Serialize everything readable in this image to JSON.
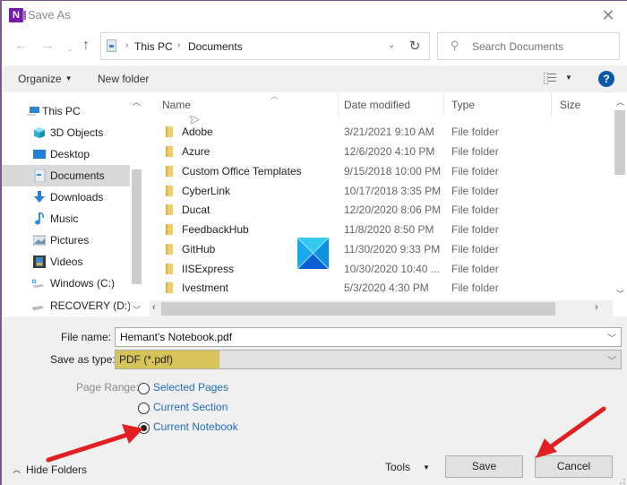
{
  "window": {
    "title": "Save As",
    "app_icon_letter": "N",
    "close_glyph": "✕"
  },
  "nav": {
    "back_glyph": "←",
    "forward_glyph": "→",
    "recent_glyph": "⌄",
    "up_glyph": "↑",
    "breadcrumb": [
      "This PC",
      "Documents"
    ],
    "separator_glyph": "›",
    "dropdown_glyph": "⌄",
    "refresh_glyph": "↻",
    "search_placeholder": "Search Documents"
  },
  "toolbar": {
    "organize_label": "Organize",
    "new_folder_label": "New folder",
    "help_label": "?"
  },
  "sidebar": {
    "items": [
      {
        "label": "This PC",
        "icon": "computer-icon",
        "selected": false
      },
      {
        "label": "3D Objects",
        "icon": "cube-icon",
        "selected": false
      },
      {
        "label": "Desktop",
        "icon": "desktop-icon",
        "selected": false
      },
      {
        "label": "Documents",
        "icon": "document-icon",
        "selected": true
      },
      {
        "label": "Downloads",
        "icon": "download-arrow-icon",
        "selected": false
      },
      {
        "label": "Music",
        "icon": "music-note-icon",
        "selected": false
      },
      {
        "label": "Pictures",
        "icon": "picture-icon",
        "selected": false
      },
      {
        "label": "Videos",
        "icon": "film-icon",
        "selected": false
      },
      {
        "label": "Windows (C:)",
        "icon": "windows-drive-icon",
        "selected": false
      },
      {
        "label": "RECOVERY (D:)",
        "icon": "drive-icon",
        "selected": false
      }
    ]
  },
  "filelist": {
    "columns": [
      "Name",
      "Date modified",
      "Type",
      "Size"
    ],
    "rows": [
      {
        "name": "Adobe",
        "date": "3/21/2021 9:10 AM",
        "type": "File folder"
      },
      {
        "name": "Azure",
        "date": "12/6/2020 4:10 PM",
        "type": "File folder"
      },
      {
        "name": "Custom Office Templates",
        "date": "9/15/2018 10:00 PM",
        "type": "File folder"
      },
      {
        "name": "CyberLink",
        "date": "10/17/2018 3:35 PM",
        "type": "File folder"
      },
      {
        "name": "Ducat",
        "date": "12/20/2020 8:06 PM",
        "type": "File folder"
      },
      {
        "name": "FeedbackHub",
        "date": "11/8/2020 8:50 PM",
        "type": "File folder"
      },
      {
        "name": "GitHub",
        "date": "11/30/2020 9:33 PM",
        "type": "File folder"
      },
      {
        "name": "IISExpress",
        "date": "10/30/2020 10:40 ...",
        "type": "File folder"
      },
      {
        "name": "Ivestment",
        "date": "5/3/2020 4:30 PM",
        "type": "File folder"
      }
    ]
  },
  "form": {
    "file_name_label": "File name:",
    "file_name_value": "Hemant's Notebook.pdf",
    "save_type_label": "Save as type:",
    "save_type_value": "PDF (*.pdf)",
    "page_range_label": "Page Range:",
    "page_range_options": [
      "Selected Pages",
      "Current Section",
      "Current Notebook"
    ],
    "page_range_selected": "Current Notebook"
  },
  "footer": {
    "hide_folders_label": "Hide Folders",
    "tools_label": "Tools",
    "save_label": "Save",
    "cancel_label": "Cancel"
  },
  "colors": {
    "highlight": "#d6c35a",
    "link": "#1f6cc4",
    "annotation_arrow": "#e02020",
    "app_brand": "#7719aa",
    "help": "#0b5ba8"
  }
}
